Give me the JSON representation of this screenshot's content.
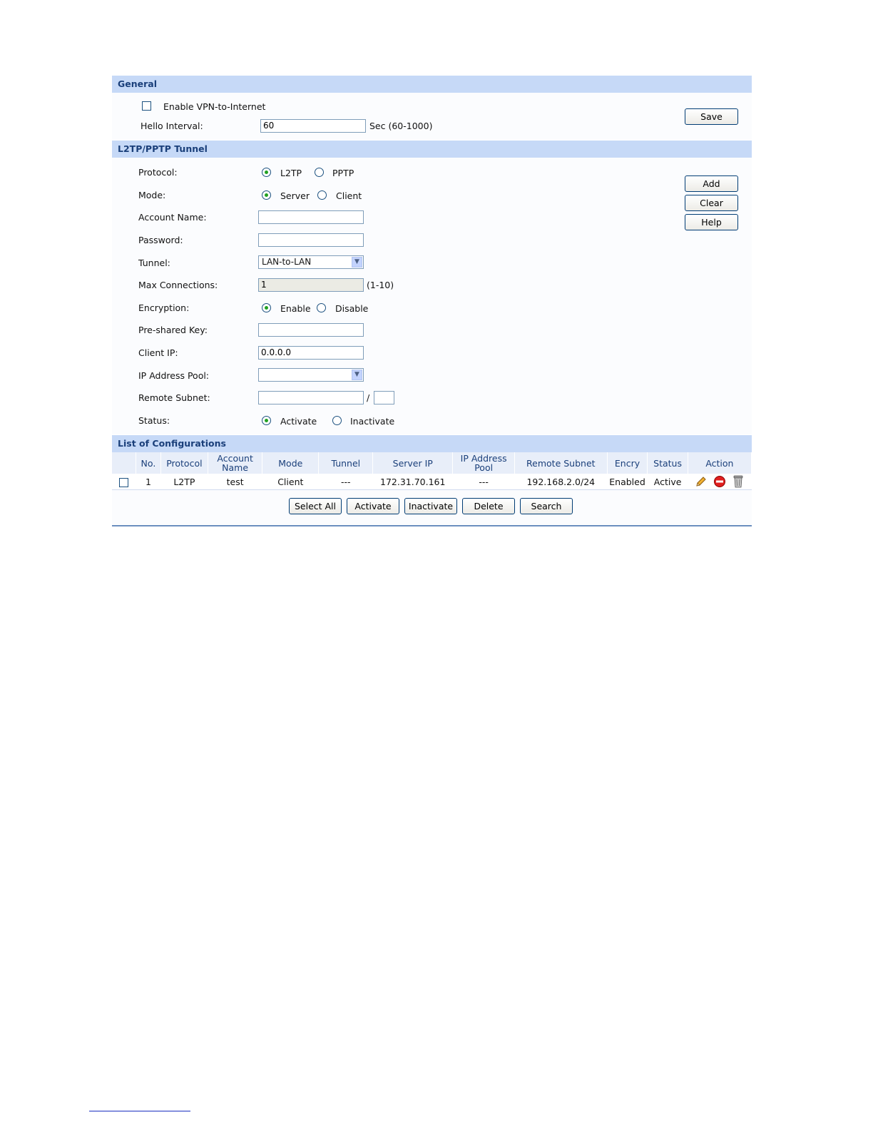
{
  "general": {
    "title": "General",
    "enable_vpn_label": "Enable VPN-to-Internet",
    "hello_interval_label": "Hello Interval:",
    "hello_interval_value": "60",
    "hello_interval_hint": "Sec (60-1000)",
    "save_label": "Save"
  },
  "tunnel": {
    "title": "L2TP/PPTP Tunnel",
    "protocol_label": "Protocol:",
    "protocol_options": [
      "L2TP",
      "PPTP"
    ],
    "protocol_selected": "L2TP",
    "mode_label": "Mode:",
    "mode_options": [
      "Server",
      "Client"
    ],
    "mode_selected": "Server",
    "account_name_label": "Account Name:",
    "account_name_value": "",
    "password_label": "Password:",
    "password_value": "",
    "tunnel_label": "Tunnel:",
    "tunnel_value": "LAN-to-LAN",
    "max_connections_label": "Max Connections:",
    "max_connections_value": "1",
    "max_connections_hint": "(1-10)",
    "encryption_label": "Encryption:",
    "encryption_options": [
      "Enable",
      "Disable"
    ],
    "encryption_selected": "Enable",
    "preshared_key_label": "Pre-shared Key:",
    "preshared_key_value": "",
    "client_ip_label": "Client IP:",
    "client_ip_value": "0.0.0.0",
    "ip_pool_label": "IP Address Pool:",
    "ip_pool_value": "",
    "remote_subnet_label": "Remote Subnet:",
    "remote_subnet_value": "",
    "remote_subnet_sep": "/",
    "remote_subnet_mask": "",
    "status_label": "Status:",
    "status_options": [
      "Activate",
      "Inactivate"
    ],
    "status_selected": "Activate",
    "add_label": "Add",
    "clear_label": "Clear",
    "help_label": "Help"
  },
  "list": {
    "title": "List of Configurations",
    "headers": [
      "No.",
      "Protocol",
      "Account Name",
      "Mode",
      "Tunnel",
      "Server IP",
      "IP Address Pool",
      "Remote Subnet",
      "Encry",
      "Status",
      "Action"
    ],
    "rows": [
      {
        "no": "1",
        "protocol": "L2TP",
        "account": "test",
        "mode": "Client",
        "tunnel": "---",
        "server_ip": "172.31.70.161",
        "pool": "---",
        "remote_subnet": "192.168.2.0/24",
        "encry": "Enabled",
        "status": "Active"
      }
    ],
    "buttons": [
      "Select All",
      "Activate",
      "Inactivate",
      "Delete",
      "Search"
    ]
  },
  "colors": {
    "section_header_bg": "#c6d9f7",
    "section_header_text": "#1a3f7a",
    "radio_dot": "#21a121"
  },
  "icons": [
    "edit-icon",
    "disable-icon",
    "trash-icon"
  ]
}
